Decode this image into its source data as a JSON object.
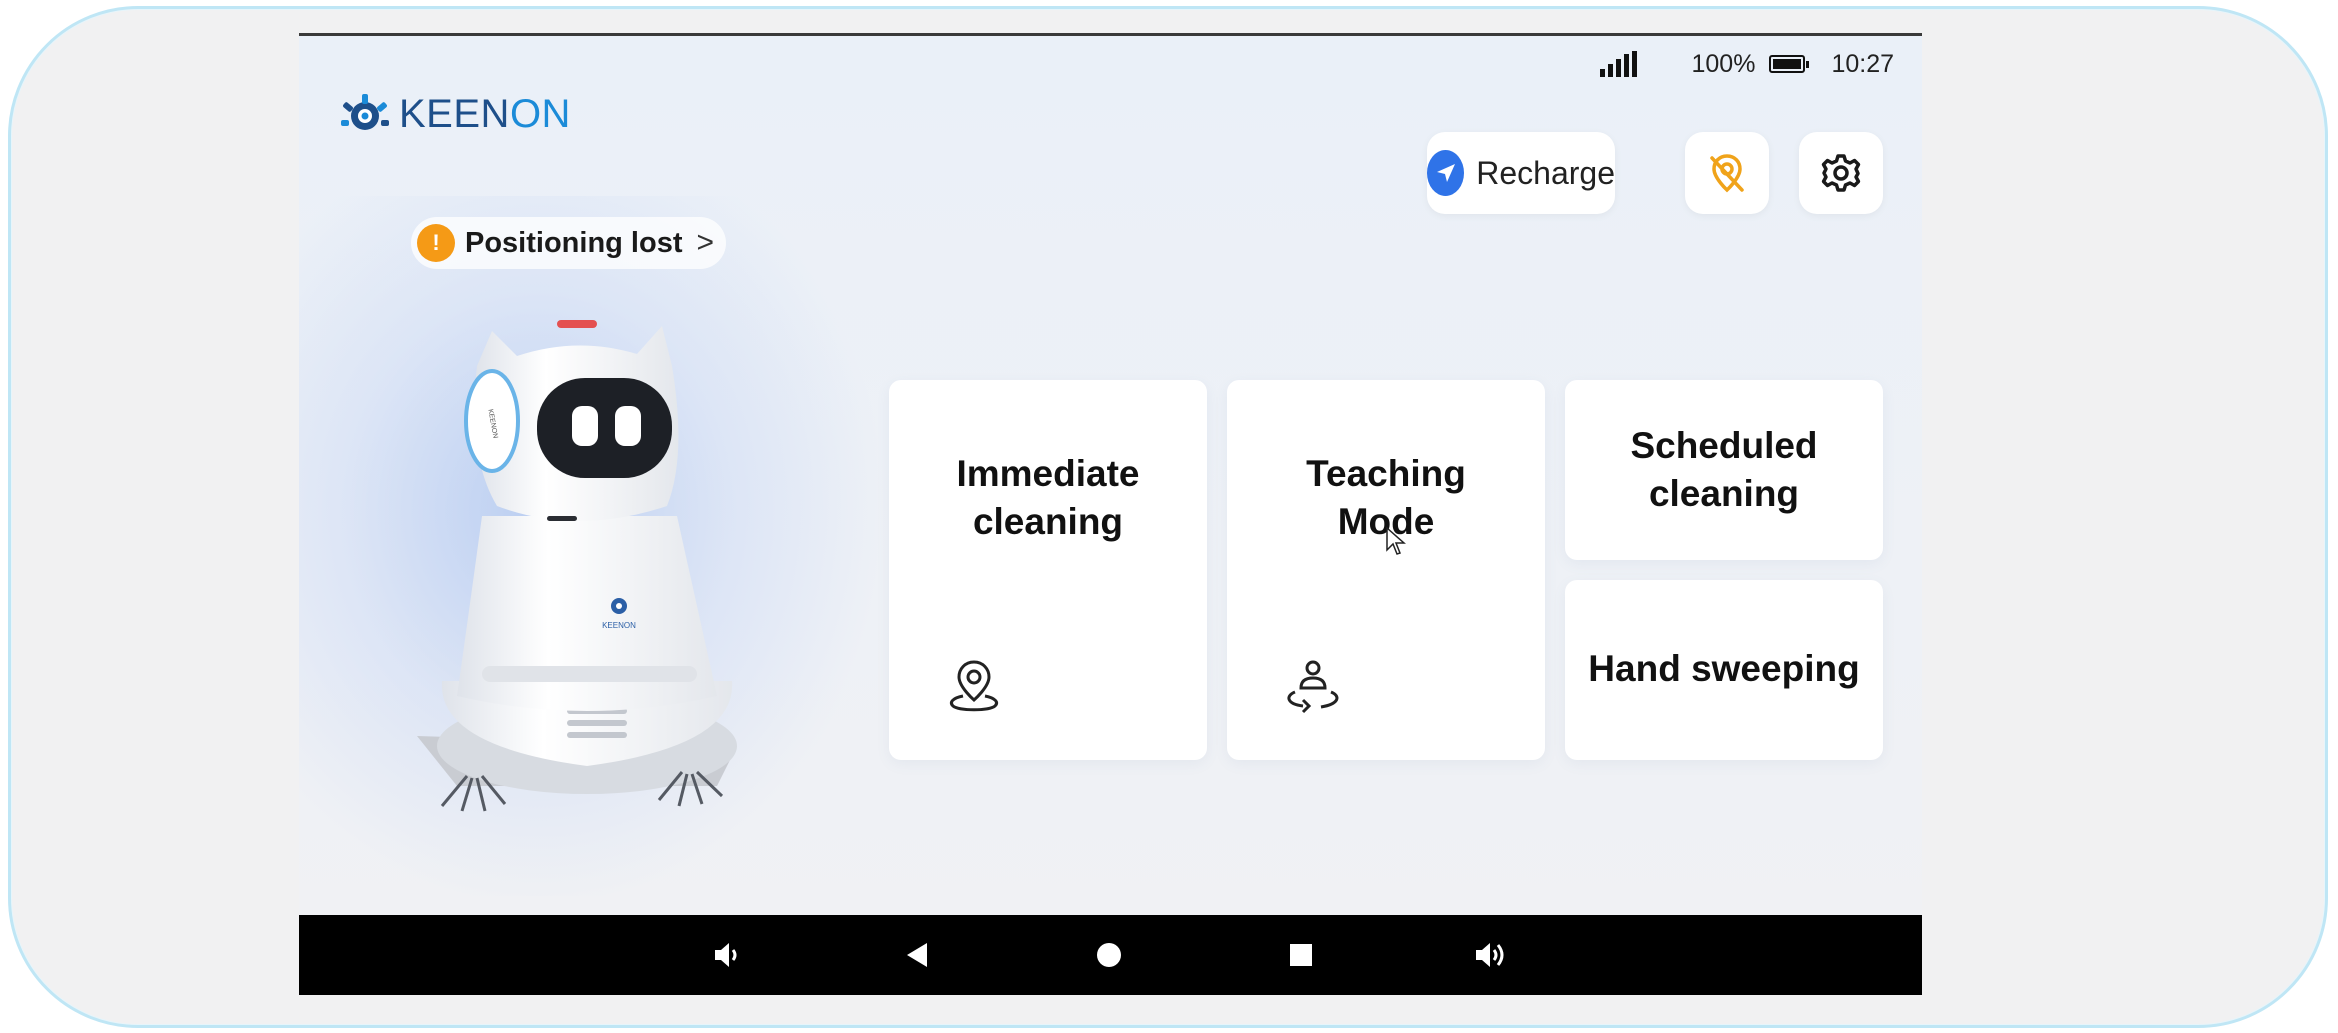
{
  "status_bar": {
    "battery": "100%",
    "time": "10:27",
    "icons": [
      "signal-icon",
      "battery-icon"
    ]
  },
  "brand": {
    "logo_prefix": "KEEN",
    "logo_suffix": "ON",
    "colors": {
      "dark": "#1e4f8a",
      "light": "#1b8bd8"
    }
  },
  "header_actions": {
    "recharge_label": "Recharge",
    "recharge_icon": "navigation-arrow-icon",
    "locate_icon": "location-off-icon",
    "settings_icon": "gear-icon"
  },
  "status": {
    "label": "Positioning lost",
    "icon": "warning-icon",
    "warning_mark": "!",
    "chevron": ">"
  },
  "robot_labels": {
    "side": "KEENON",
    "front": "KEENON"
  },
  "tiles": [
    {
      "line1": "Immediate",
      "line2": "cleaning",
      "icon": "location-pin-icon"
    },
    {
      "line1": "Teaching",
      "line2": "Mode",
      "icon": "person-path-icon"
    },
    {
      "line1": "Scheduled",
      "line2": "cleaning"
    },
    {
      "line1": "Hand sweeping"
    }
  ],
  "nav_bar": {
    "icons": [
      "volume-down-icon",
      "back-icon",
      "home-icon",
      "recents-icon",
      "volume-up-icon"
    ]
  },
  "colors": {
    "accent_blue": "#2f73e8",
    "warning_orange": "#f59a16",
    "locate_icon_color": "#f0a31a"
  }
}
